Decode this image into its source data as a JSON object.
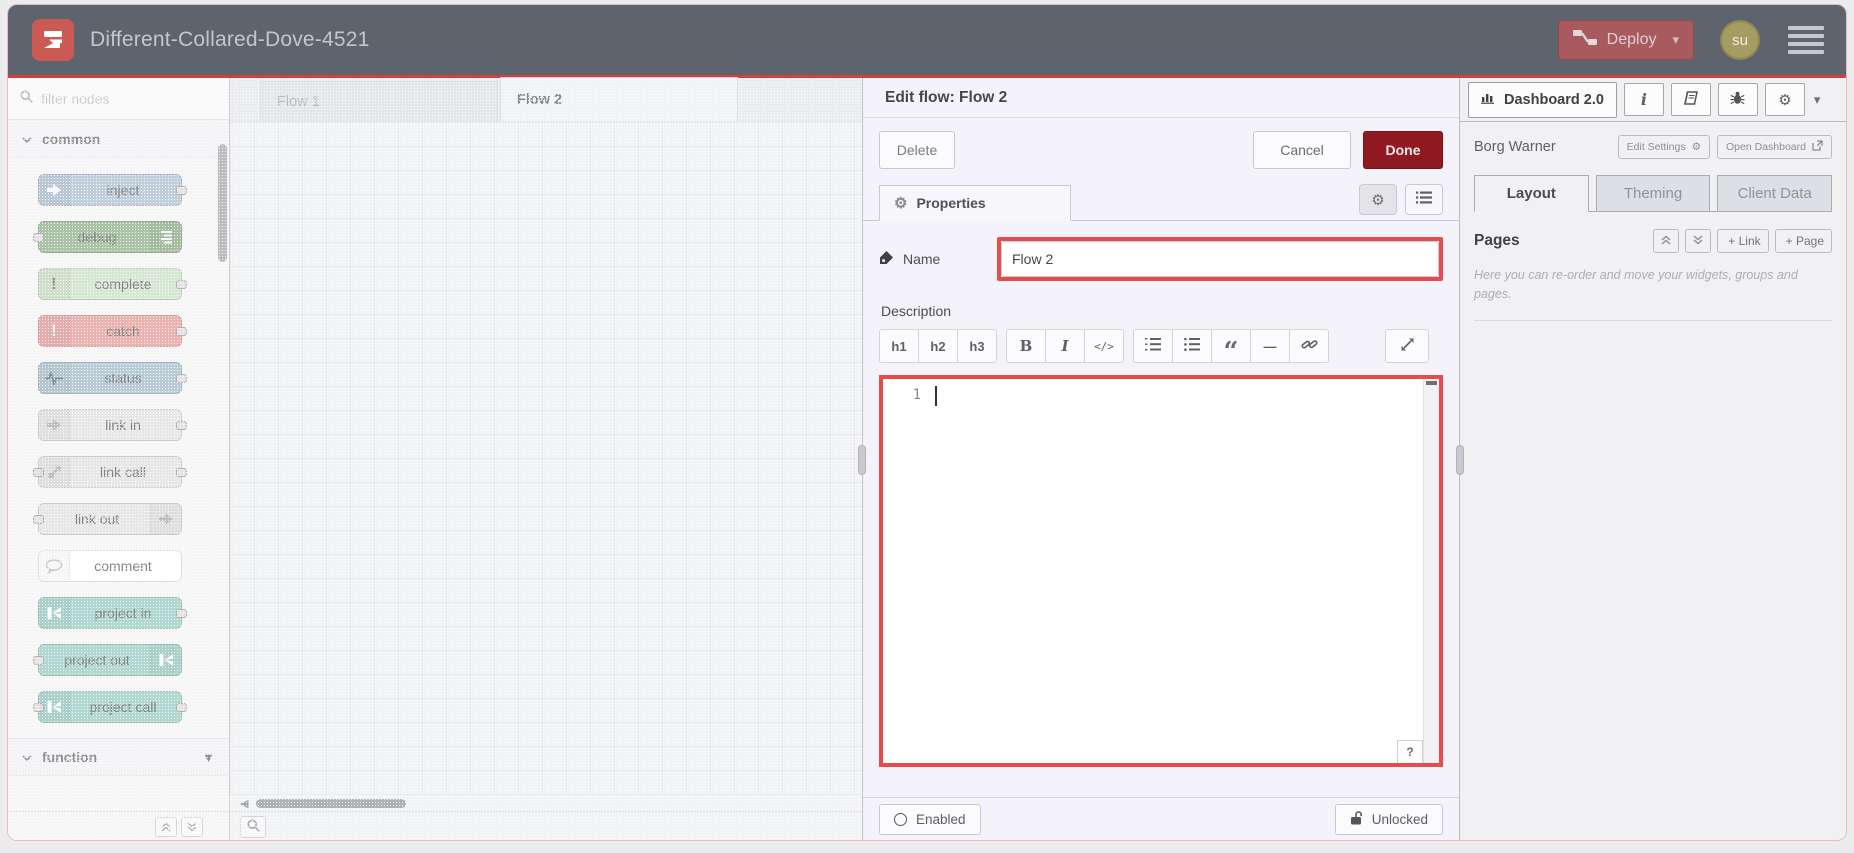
{
  "header": {
    "title": "Different-Collared-Dove-4521",
    "deploy_label": "Deploy",
    "avatar_initials": "su"
  },
  "colors": {
    "header_bg": "#5d646d",
    "header_underline": "#d33f3f",
    "deploy_button": "#a85a5e",
    "done_button": "#8f1a22",
    "highlight_border": "#e74c4c",
    "logo_bg": "#cb5a55",
    "node_inject": "#a6bbcf",
    "node_debug": "#87a980",
    "node_complete": "#c5ddc0",
    "node_catch": "#e49191",
    "node_status": "#9db8c6",
    "node_link": "#dddddd",
    "node_comment": "#ffffff",
    "node_project": "#8ec7bc"
  },
  "palette": {
    "search_placeholder": "filter nodes",
    "categories": [
      {
        "label": "common"
      },
      {
        "label": "function"
      }
    ],
    "nodes": [
      {
        "label": "inject",
        "icon": "arrow-right-icon"
      },
      {
        "label": "debug",
        "icon": "text-lines-icon"
      },
      {
        "label": "complete",
        "icon": "exclamation-icon"
      },
      {
        "label": "catch",
        "icon": "exclamation-icon"
      },
      {
        "label": "status",
        "icon": "heartbeat-icon"
      },
      {
        "label": "link in",
        "icon": "link-arrow-icon"
      },
      {
        "label": "link call",
        "icon": "link-call-icon"
      },
      {
        "label": "link out",
        "icon": "link-arrow-icon"
      },
      {
        "label": "comment",
        "icon": "speech-bubble-icon"
      },
      {
        "label": "project in",
        "icon": "project-mark-icon"
      },
      {
        "label": "project out",
        "icon": "project-mark-icon"
      },
      {
        "label": "project call",
        "icon": "project-mark-icon"
      }
    ]
  },
  "workspace": {
    "tabs": [
      {
        "label": "Flow 1",
        "active": false
      },
      {
        "label": "Flow 2",
        "active": true
      }
    ]
  },
  "dialog": {
    "title": "Edit flow: Flow 2",
    "delete_label": "Delete",
    "cancel_label": "Cancel",
    "done_label": "Done",
    "properties_tab": "Properties",
    "name_label": "Name",
    "name_value": "Flow 2",
    "description_label": "Description",
    "toolbar": {
      "h1": "h1",
      "h2": "h2",
      "h3": "h3",
      "bold": "B",
      "italic": "I",
      "code": "</>",
      "quote_glyph": "“",
      "hr_glyph": "—"
    },
    "editor": {
      "line_number": "1"
    },
    "help_label": "?",
    "enabled_label": "Enabled",
    "unlocked_label": "Unlocked"
  },
  "sidebar": {
    "tab_label": "Dashboard 2.0",
    "instance_name": "Borg Warner",
    "edit_settings_label": "Edit Settings",
    "open_dashboard_label": "Open Dashboard",
    "tabs": [
      {
        "label": "Layout",
        "active": true
      },
      {
        "label": "Theming",
        "active": false
      },
      {
        "label": "Client Data",
        "active": false
      }
    ],
    "pages": {
      "title": "Pages",
      "add_link_label": "+ Link",
      "add_page_label": "+ Page",
      "help_text": "Here you can re-order and move your widgets, groups and pages."
    }
  }
}
